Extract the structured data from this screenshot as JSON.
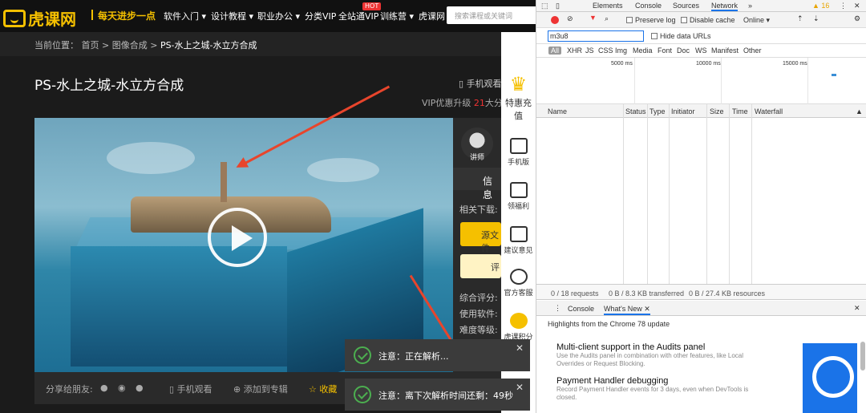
{
  "site": {
    "logo_text": "虎课网",
    "slogan": "每天进步一点",
    "nav": [
      "软件入门",
      "设计教程",
      "职业办公",
      "分类VIP",
      "全站通VIP",
      "训练营",
      "虎课网"
    ],
    "hot_badge": "HOT",
    "search_placeholder": "搜索课程或关键词"
  },
  "breadcrumb": {
    "prefix": "当前位置：",
    "items": [
      "首页",
      "图像合成"
    ],
    "current": "PS-水上之城-水立方合成"
  },
  "page": {
    "title": "PS-水上之城-水立方合成",
    "phone_watch": "手机观看",
    "vip_prefix": "VIP优惠升级",
    "vip_num": "21",
    "vip_suffix": "大分类"
  },
  "panel": {
    "avatar_label": "讲师",
    "info_tab": "信息",
    "related": "相关下载:",
    "btn1": "源文件",
    "btn2": "评",
    "score": "综合评分:",
    "software": "使用软件:",
    "difficulty": "难度等级:"
  },
  "share": {
    "label": "分享给朋友:",
    "phone": "手机观看",
    "add": "添加到专辑",
    "fav": "收藏"
  },
  "sidebar": [
    {
      "label": "特惠充值"
    },
    {
      "label": "手机版"
    },
    {
      "label": "领福利"
    },
    {
      "label": "建议意见"
    },
    {
      "label": "官方客服"
    },
    {
      "label": "虎课积分"
    }
  ],
  "notices": [
    {
      "text": "注意：正在解析..."
    },
    {
      "text": "注意：离下次解析时间还剩：49秒"
    }
  ],
  "devtools": {
    "tabs": [
      "Elements",
      "Console",
      "Sources",
      "Network"
    ],
    "warn_count": "16",
    "preserve_log": "Preserve log",
    "disable_cache": "Disable cache",
    "online": "Online",
    "filter_value": "m3u8",
    "hide_data_urls": "Hide data URLs",
    "types": [
      "All",
      "XHR",
      "JS",
      "CSS",
      "Img",
      "Media",
      "Font",
      "Doc",
      "WS",
      "Manifest",
      "Other"
    ],
    "timeline_ms": [
      "5000 ms",
      "10000 ms",
      "15000 ms"
    ],
    "columns": [
      "Name",
      "Status",
      "Type",
      "Initiator",
      "Size",
      "Time",
      "Waterfall"
    ],
    "status_bar": [
      "0 / 18 requests",
      "0 B / 8.3 KB transferred",
      "0 B / 27.4 KB resources"
    ],
    "drawer_tabs": [
      "Console",
      "What's New"
    ],
    "highlights": "Highlights from the Chrome 78 update",
    "whats_new": [
      {
        "title": "Multi-client support in the Audits panel",
        "desc": "Use the Audits panel in combination with other features, like Local Overrides or Request Blocking."
      },
      {
        "title": "Payment Handler debugging",
        "desc": "Record Payment Handler events for 3 days, even when DevTools is closed."
      }
    ]
  }
}
